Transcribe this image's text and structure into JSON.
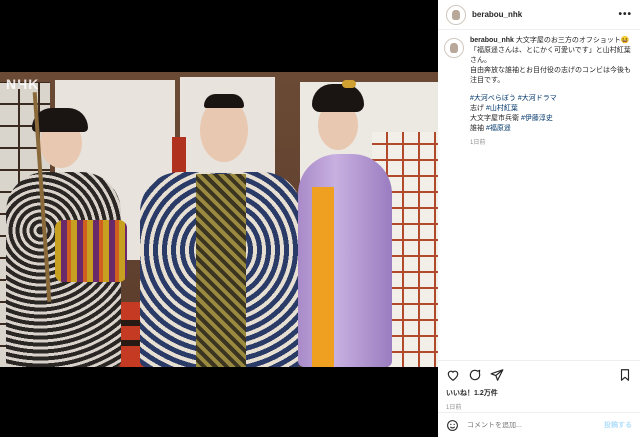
{
  "media": {
    "watermark": "NHK"
  },
  "post": {
    "username": "berabou_nhk",
    "more_icon": "more-horizontal-icon",
    "caption": {
      "username": "berabou_nhk",
      "line1": "大文字屋のお三方のオフショット😆",
      "line2": "「福原遥さんは、とにかく可愛いです」と山村紅葉さん。",
      "line3": "自由奔放な誰袖とお目付役の志げのコンビは今後も注目です。",
      "hashtags_line": [
        "#大河べらぼう",
        "#大河ドラマ"
      ],
      "cast": [
        {
          "role": "志げ",
          "tag": "#山村紅葉"
        },
        {
          "role": "大文字屋市兵衛",
          "tag": "#伊藤淳史"
        },
        {
          "role": "誰袖",
          "tag": "#福原遥"
        }
      ],
      "time": "1日前"
    },
    "likes": "いいね！1.2万件",
    "date": "1日前",
    "comment_placeholder": "コメントを追加...",
    "post_button": "投稿する"
  }
}
